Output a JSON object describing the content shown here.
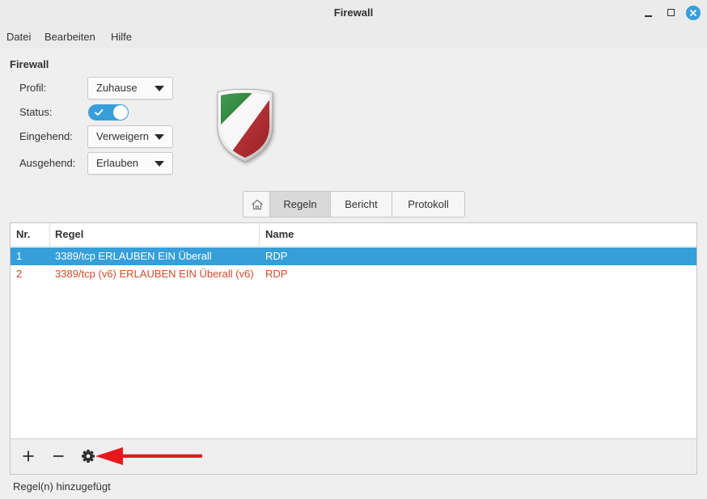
{
  "window": {
    "title": "Firewall",
    "controls": {
      "minimize_icon": "minimize-icon",
      "maximize_icon": "maximize-icon",
      "close_icon": "close-icon"
    }
  },
  "menubar": {
    "items": [
      {
        "label": "Datei"
      },
      {
        "label": "Bearbeiten"
      },
      {
        "label": "Hilfe"
      }
    ]
  },
  "firewall": {
    "heading": "Firewall",
    "logo_icon": "gufw-shield-icon",
    "profile": {
      "label": "Profil:",
      "value": "Zuhause"
    },
    "status": {
      "label": "Status:",
      "enabled": true
    },
    "incoming": {
      "label": "Eingehend:",
      "value": "Verweigern"
    },
    "outgoing": {
      "label": "Ausgehend:",
      "value": "Erlauben"
    }
  },
  "tabs": {
    "home_icon": "home-icon",
    "items": [
      {
        "label": "Regeln",
        "active": true
      },
      {
        "label": "Bericht",
        "active": false
      },
      {
        "label": "Protokoll",
        "active": false
      }
    ]
  },
  "rules_table": {
    "columns": {
      "nr": "Nr.",
      "rule": "Regel",
      "name": "Name"
    },
    "rows": [
      {
        "nr": "1",
        "rule": "3389/tcp ERLAUBEN EIN Überall",
        "name": "RDP",
        "selected": true
      },
      {
        "nr": "2",
        "rule": "3389/tcp (v6) ERLAUBEN EIN Überall (v6)",
        "name": "RDP",
        "selected": false,
        "color": "#d04a2c"
      }
    ]
  },
  "toolbar": {
    "add_icon": "plus-icon",
    "remove_icon": "minus-icon",
    "edit_icon": "gear-icon",
    "annotation_icon": "red-arrow-icon"
  },
  "statusbar": {
    "text": "Regel(n) hinzugefügt"
  },
  "colors": {
    "accent": "#369fd9",
    "annotation_arrow": "#e8171e"
  }
}
